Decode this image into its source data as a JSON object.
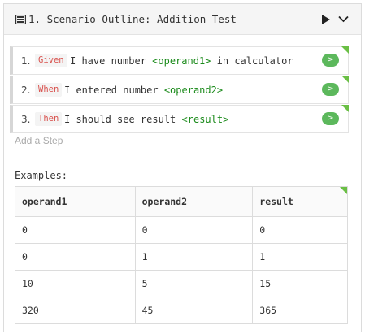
{
  "scenario": {
    "number": "1.",
    "title": "Scenario Outline: Addition Test"
  },
  "steps": [
    {
      "number": "1.",
      "keyword": "Given",
      "text": "I have number",
      "param": "<operand1>",
      "suffix": "in calculator",
      "run_label": ">"
    },
    {
      "number": "2.",
      "keyword": "When",
      "text": "I entered number",
      "param": "<operand2>",
      "suffix": "",
      "run_label": ">"
    },
    {
      "number": "3.",
      "keyword": "Then",
      "text": "I should see result",
      "param": "<result>",
      "suffix": "",
      "run_label": ">"
    }
  ],
  "add_step_placeholder": "Add a Step",
  "examples": {
    "label": "Examples:",
    "headers": [
      "operand1",
      "operand2",
      "result"
    ],
    "rows": [
      [
        "0",
        "0",
        "0"
      ],
      [
        "0",
        "1",
        "1"
      ],
      [
        "10",
        "5",
        "15"
      ],
      [
        "320",
        "45",
        "365"
      ]
    ]
  },
  "colors": {
    "keyword": "#d9534f",
    "param": "#1a8a1a",
    "run_button": "#5cb85c",
    "status_corner": "#6abf45"
  },
  "icons": [
    "scenario-outline-icon",
    "play-icon",
    "chevron-down-icon"
  ]
}
